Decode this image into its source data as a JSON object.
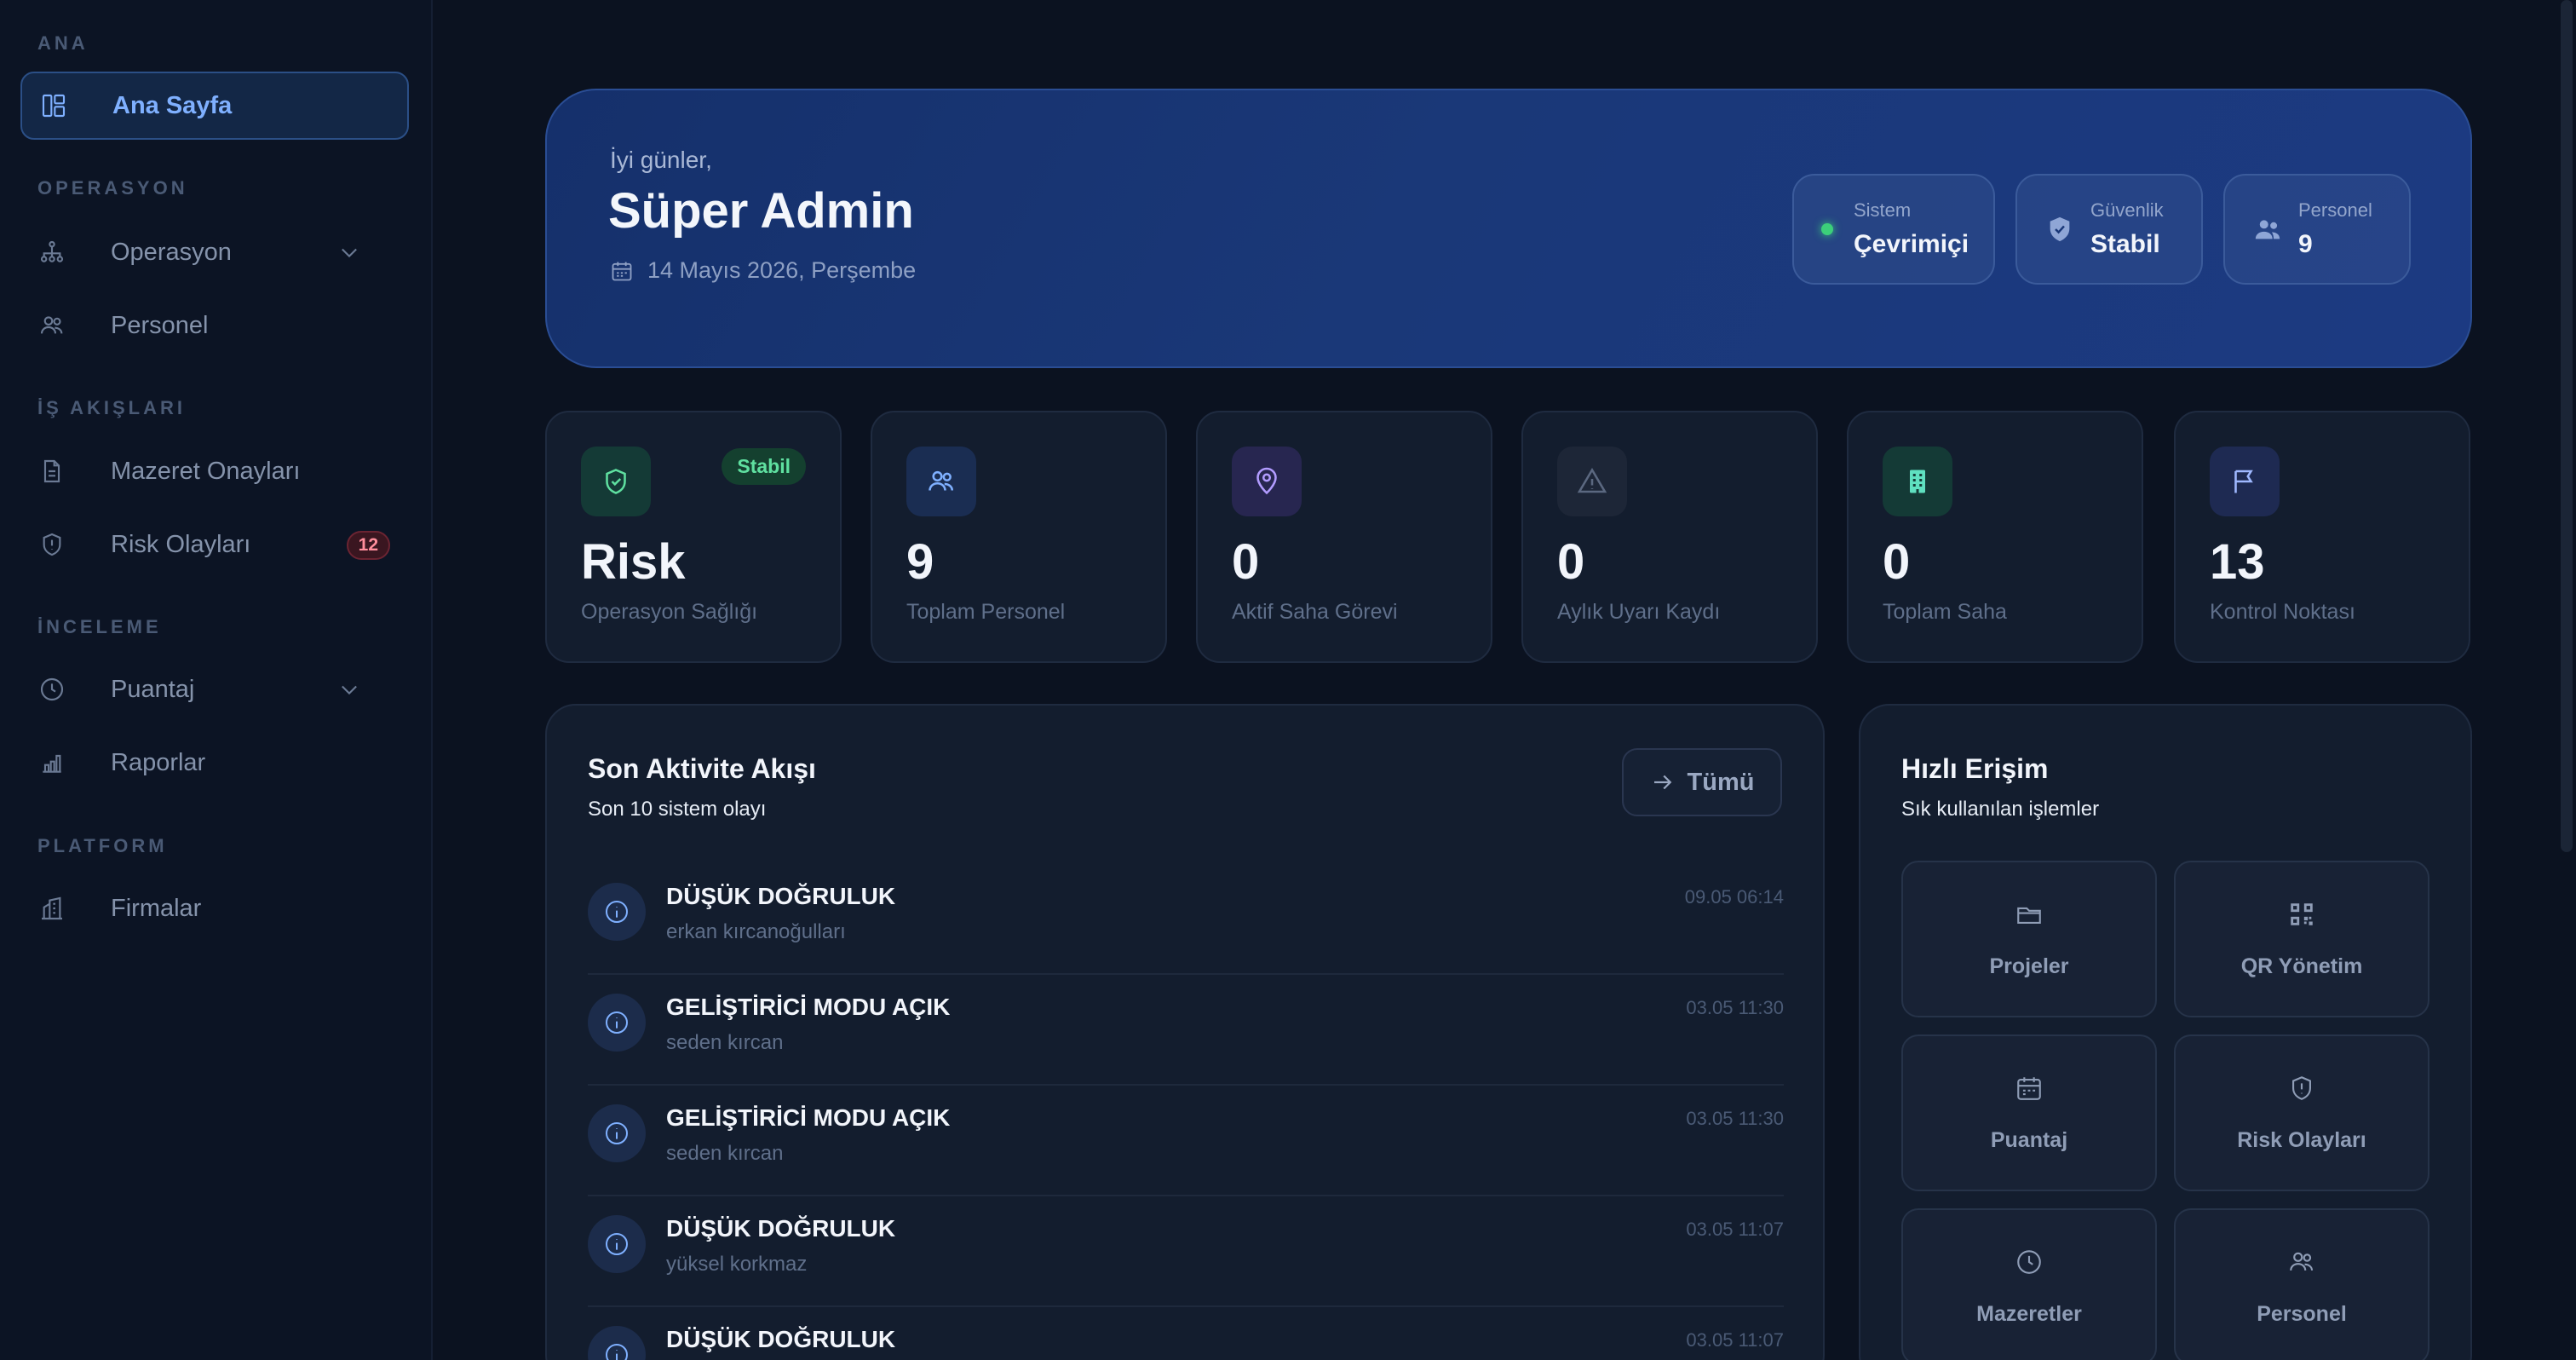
{
  "sidebar": {
    "sections": {
      "ana": "ANA",
      "operasyon": "OPERASYON",
      "is_akislari": "İŞ AKIŞLARI",
      "inceleme": "İNCELEME",
      "platform": "PLATFORM"
    },
    "items": {
      "ana_sayfa": "Ana Sayfa",
      "operasyon": "Operasyon",
      "personel": "Personel",
      "mazeret": "Mazeret Onayları",
      "risk": "Risk Olayları",
      "risk_badge": "12",
      "puantaj": "Puantaj",
      "raporlar": "Raporlar",
      "firmalar": "Firmalar"
    }
  },
  "hero": {
    "greeting": "İyi günler,",
    "name": "Süper Admin",
    "date": "14 Mayıs 2026, Perşembe",
    "pills": {
      "sistem_label": "Sistem",
      "sistem_value": "Çevrimiçi",
      "guvenlik_label": "Güvenlik",
      "guvenlik_value": "Stabil",
      "personel_label": "Personel",
      "personel_value": "9"
    }
  },
  "stats": {
    "risk": {
      "value": "Risk",
      "label": "Operasyon Sağlığı",
      "badge": "Stabil"
    },
    "personel": {
      "value": "9",
      "label": "Toplam Personel"
    },
    "saha_gorevi": {
      "value": "0",
      "label": "Aktif Saha Görevi"
    },
    "uyari": {
      "value": "0",
      "label": "Aylık Uyarı Kaydı"
    },
    "saha": {
      "value": "0",
      "label": "Toplam Saha"
    },
    "kontrol": {
      "value": "13",
      "label": "Kontrol Noktası"
    }
  },
  "activity": {
    "title": "Son Aktivite Akışı",
    "subtitle": "Son 10 sistem olayı",
    "all_label": "Tümü",
    "rows": [
      {
        "title": "DÜŞÜK DOĞRULUK",
        "user": "erkan kırcanoğulları",
        "time": "09.05 06:14"
      },
      {
        "title": "GELİŞTİRİCİ MODU AÇIK",
        "user": "seden kırcan",
        "time": "03.05 11:30"
      },
      {
        "title": "GELİŞTİRİCİ MODU AÇIK",
        "user": "seden kırcan",
        "time": "03.05 11:30"
      },
      {
        "title": "DÜŞÜK DOĞRULUK",
        "user": "yüksel korkmaz",
        "time": "03.05 11:07"
      },
      {
        "title": "DÜŞÜK DOĞRULUK",
        "user": "",
        "time": "03.05 11:07"
      }
    ]
  },
  "quick": {
    "title": "Hızlı Erişim",
    "subtitle": "Sık kullanılan işlemler",
    "items": {
      "projeler": "Projeler",
      "qr": "QR Yönetim",
      "puantaj": "Puantaj",
      "risk": "Risk Olayları",
      "mazeretler": "Mazeretler",
      "personel": "Personel"
    }
  },
  "colors": {
    "accent": "#7fb0ff",
    "success": "#3ccf7a",
    "danger": "#ff8e9c",
    "background": "#0b1220"
  }
}
